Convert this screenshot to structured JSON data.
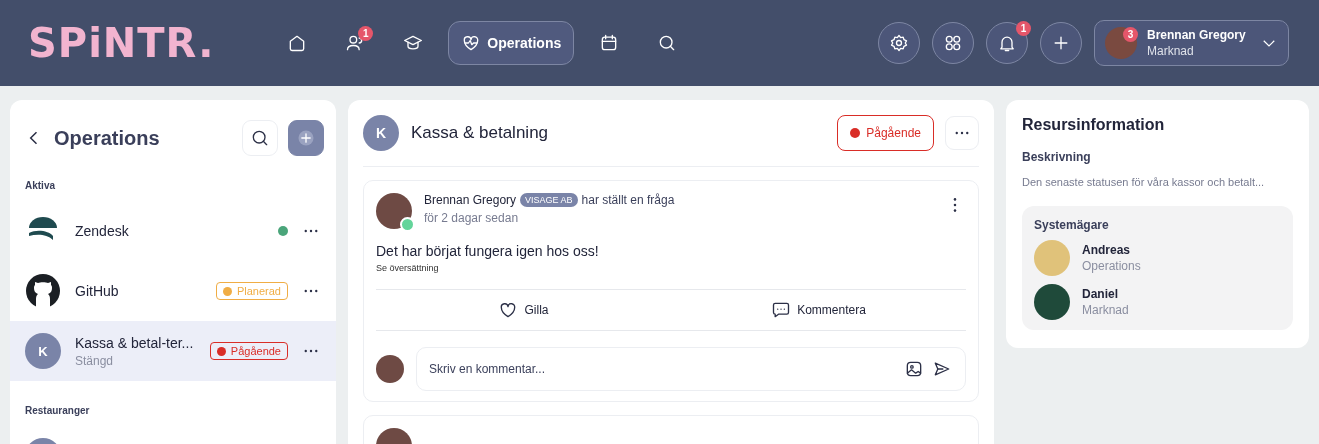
{
  "header": {
    "logo": "SPiNTR.",
    "nav": [
      {
        "selected": false
      },
      {
        "selected": false,
        "badge": "1"
      },
      {
        "selected": false
      },
      {
        "selected": true,
        "label": "Operations"
      },
      {
        "selected": false
      },
      {
        "selected": false
      }
    ],
    "notifications_badge": "1",
    "user": {
      "name": "Brennan Gregory",
      "department": "Marknad",
      "badge": "3"
    }
  },
  "sidebar": {
    "title": "Operations",
    "sections": [
      {
        "label": "Aktiva",
        "items": [
          {
            "kind": "zendesk",
            "name": "Zendesk",
            "selected": false,
            "status": {
              "color": "#4aa57a"
            }
          },
          {
            "kind": "github",
            "name": "GitHub",
            "selected": false,
            "status": {
              "label": "Planerad",
              "color": "#f0ad45"
            }
          },
          {
            "kind": "letter",
            "initial": "K",
            "name": "Kassa & betal-ter...",
            "subtitle": "Stängd",
            "selected": true,
            "status": {
              "label": "Pågående",
              "color": "#d92d27"
            }
          }
        ]
      },
      {
        "label": "Restauranger",
        "items": [
          {
            "kind": "letter",
            "selected": false
          }
        ]
      }
    ]
  },
  "feed": {
    "initial": "K",
    "title": "Kassa & betalning",
    "status": {
      "label": "Pågående",
      "color": "#d92d27"
    },
    "posts": [
      {
        "author": "Brennan Gregory",
        "company": "VISAGE AB",
        "action": "har ställt en fråga",
        "time": "för 2 dagar sedan",
        "online": true,
        "text": "Det har börjat fungera igen hos oss!",
        "translate": "Se översättning",
        "like": "Gilla",
        "comment": "Kommentera",
        "placeholder": "Skriv en kommentar..."
      }
    ]
  },
  "resource": {
    "title": "Resursinformation",
    "description_label": "Beskrivning",
    "description": "Den senaste statusen för våra kassor och betalt...",
    "owners_title": "Systemägare",
    "owners": [
      {
        "name": "Andreas",
        "department": "Operations",
        "color": "#e0c27a"
      },
      {
        "name": "Daniel",
        "department": "Marknad",
        "color": "#1f4a3a"
      }
    ]
  }
}
